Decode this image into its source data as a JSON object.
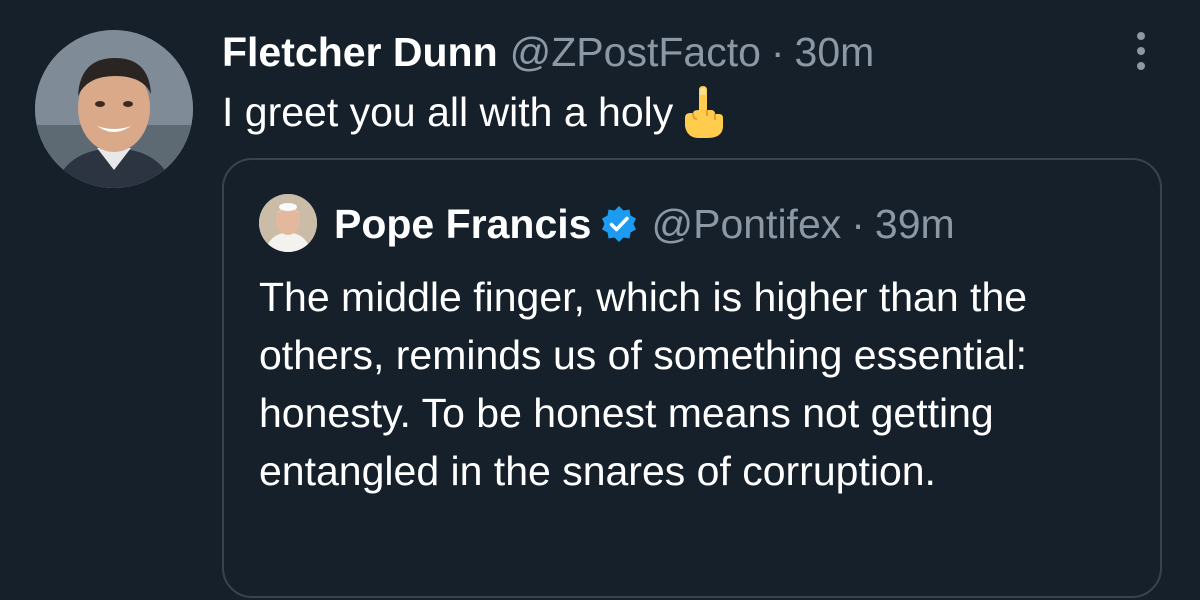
{
  "tweet": {
    "author_name": "Fletcher Dunn",
    "author_handle": "@ZPostFacto",
    "separator": "·",
    "time": "30m",
    "text": "I greet you all with a holy",
    "emoji": "middle-finger-emoji",
    "more_icon": "more-options-icon"
  },
  "quoted_tweet": {
    "author_name": "Pope Francis",
    "verified_icon": "verified-badge-icon",
    "author_handle": "@Pontifex",
    "separator": "·",
    "time": "39m",
    "text": "The middle finger, which is higher than the others, reminds us of something essential: honesty. To be honest means not getting entangled in the snares of corruption."
  },
  "colors": {
    "background": "#15202b",
    "secondary_text": "#8b98a5",
    "border": "#38444d",
    "verified_blue": "#1d9bf0",
    "emoji_yellow": "#ffcc4d"
  }
}
